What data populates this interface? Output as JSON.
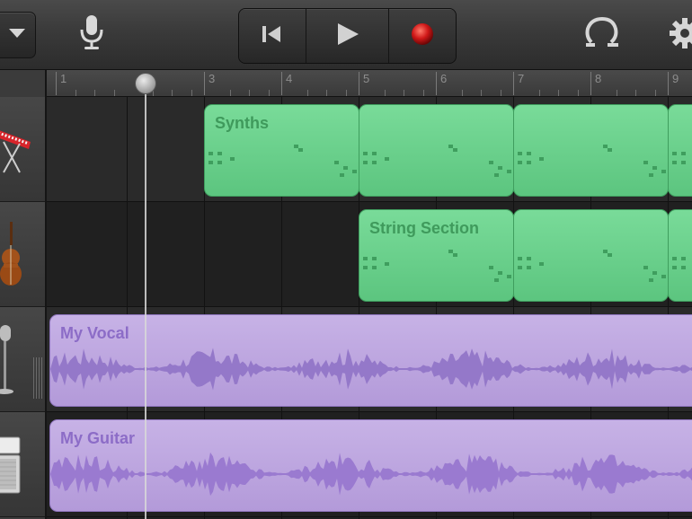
{
  "toolbar": {
    "menu_icon": "chevron-down-icon",
    "mic_icon": "microphone-icon",
    "transport": {
      "rewind_icon": "skip-to-start-icon",
      "play_icon": "play-icon",
      "record_icon": "record-icon"
    },
    "loop_icon": "loop-browser-icon",
    "settings_icon": "gear-icon"
  },
  "ruler": {
    "bars": [
      "1",
      "2",
      "3",
      "4",
      "5",
      "6",
      "7",
      "8",
      "9"
    ]
  },
  "tracks": [
    {
      "instrument_icon": "keyboard-synth-icon",
      "region_label": "Synths",
      "type": "midi",
      "color": "#6fd38f"
    },
    {
      "instrument_icon": "violin-icon",
      "region_label": "String Section",
      "type": "midi",
      "color": "#6fd38f"
    },
    {
      "instrument_icon": "microphone-stand-icon",
      "region_label": "My Vocal",
      "type": "audio",
      "color": "#bfa8e0"
    },
    {
      "instrument_icon": "guitar-amp-icon",
      "region_label": "My Guitar",
      "type": "audio",
      "color": "#bfa8e0"
    }
  ],
  "colors": {
    "midi_region": "#6fd38f",
    "audio_region": "#bfa8e0",
    "record": "#d01818"
  }
}
